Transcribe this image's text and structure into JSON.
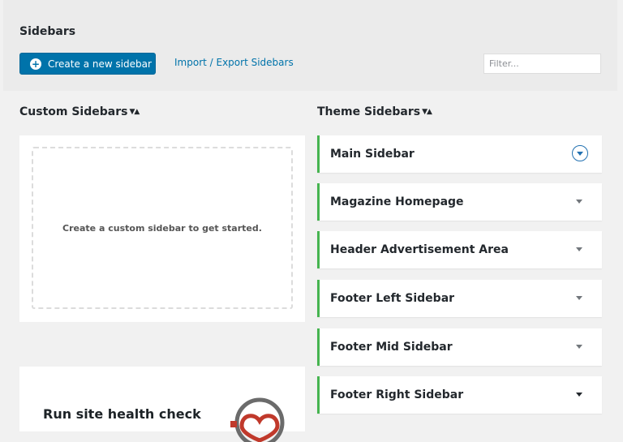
{
  "header": {
    "title": "Sidebars",
    "create_button_label": "Create a new sidebar",
    "import_export_link": "Import / Export Sidebars",
    "filter_placeholder": "Filter..."
  },
  "custom_sidebars": {
    "heading": "Custom Sidebars",
    "empty_message": "Create a custom sidebar to get started."
  },
  "theme_sidebars": {
    "heading": "Theme Sidebars",
    "items": [
      {
        "label": "Main Sidebar"
      },
      {
        "label": "Magazine Homepage"
      },
      {
        "label": "Header Advertisement Area"
      },
      {
        "label": "Footer Left Sidebar"
      },
      {
        "label": "Footer Mid Sidebar"
      },
      {
        "label": "Footer Right Sidebar"
      }
    ]
  },
  "health_card": {
    "title": "Run site health check"
  },
  "colors": {
    "primary": "#0073aa",
    "active_border": "#46b450",
    "focus_ring": "#2271b1"
  },
  "icons": {
    "create_button": "plus-circle-icon",
    "sort": "sort-arrows-icon",
    "expand": "chevron-down-icon",
    "health": "heart-monitor-icon"
  }
}
